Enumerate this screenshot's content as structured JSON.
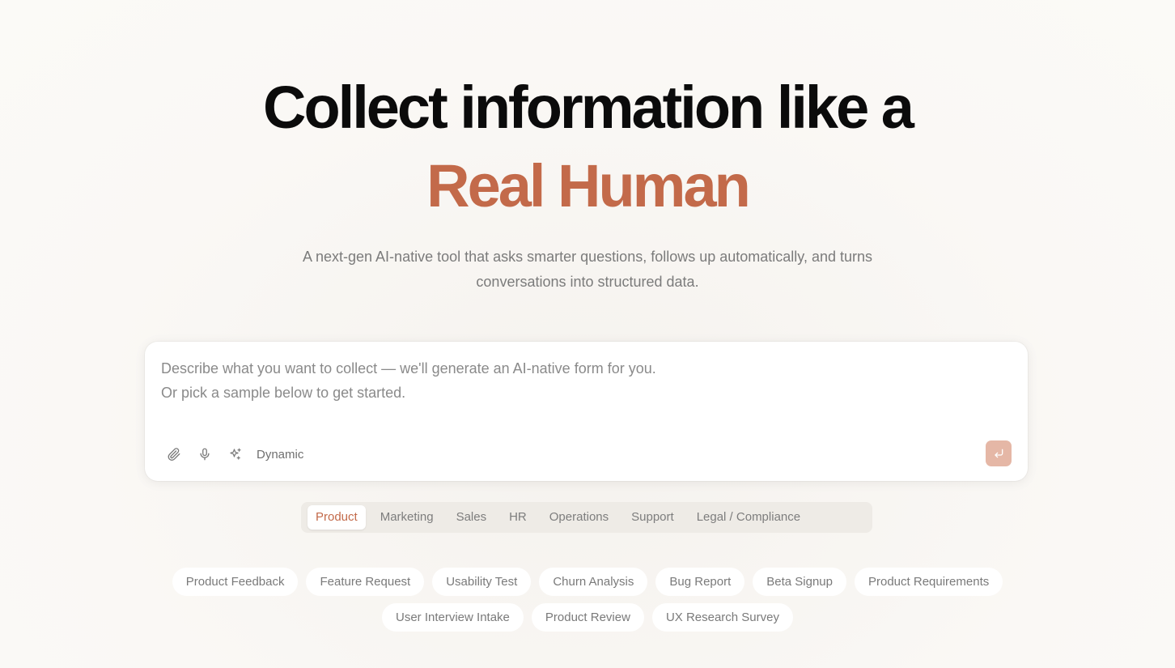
{
  "hero": {
    "title_line1": "Collect information like a",
    "title_line2": "Real Human",
    "subtitle_line1": "A next-gen AI-native tool that asks smarter questions, follows up automatically, and turns",
    "subtitle_line2": "conversations into structured data."
  },
  "composer": {
    "placeholder_line1": "Describe what you want to collect — we'll generate an AI-native form for you.",
    "placeholder_line2": "Or pick a sample below to get started.",
    "mode_label": "Dynamic",
    "icons": [
      "paperclip-icon",
      "microphone-icon",
      "sparkles-icon",
      "enter-icon"
    ]
  },
  "tabs": {
    "active": "Product",
    "items": [
      {
        "label": "Product"
      },
      {
        "label": "Marketing"
      },
      {
        "label": "Sales"
      },
      {
        "label": "HR"
      },
      {
        "label": "Operations"
      },
      {
        "label": "Support"
      },
      {
        "label": "Legal / Compliance"
      }
    ]
  },
  "samples": {
    "row1": [
      {
        "label": "Product Feedback"
      },
      {
        "label": "Feature Request"
      },
      {
        "label": "Usability Test"
      },
      {
        "label": "Churn Analysis"
      },
      {
        "label": "Bug Report"
      },
      {
        "label": "Beta Signup"
      },
      {
        "label": "Product Requirements"
      }
    ],
    "row2": [
      {
        "label": "User Interview Intake"
      },
      {
        "label": "Product Review"
      },
      {
        "label": "UX Research Survey"
      }
    ]
  },
  "colors": {
    "accent": "#c36a4a",
    "send_button": "#e5b7a6",
    "background": "#f9f7f4",
    "tab_bar": "#eeebe6"
  }
}
